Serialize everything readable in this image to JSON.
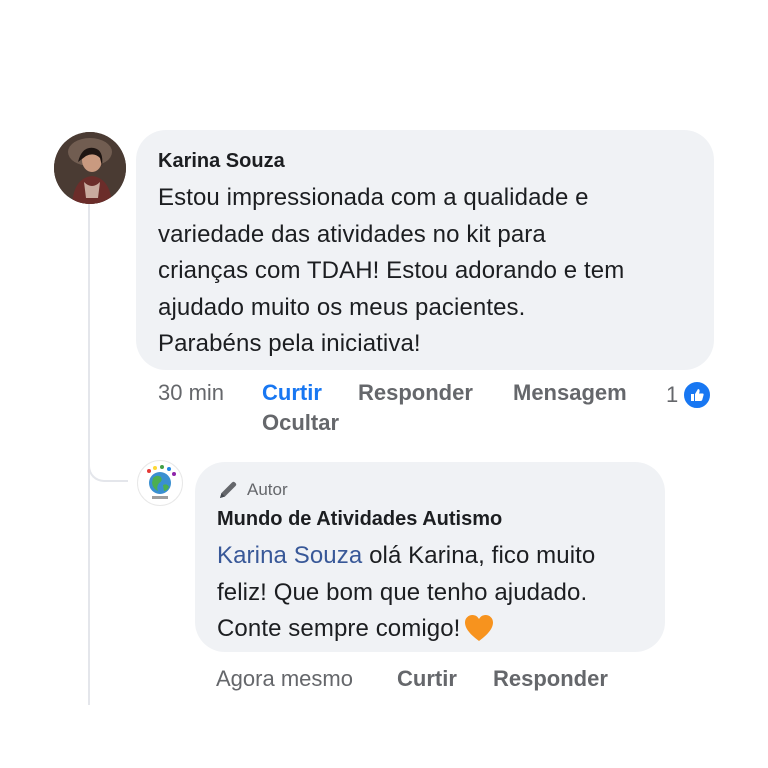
{
  "main_comment": {
    "author": "Karina Souza",
    "lines": [
      "Estou impressionada com a qualidade e",
      "variedade das atividades no kit para",
      "crianças com TDAH! Estou adorando e tem",
      "ajudado muito os meus pacientes.",
      "Parabéns pela iniciativa!"
    ],
    "time": "30 min",
    "like_label": "Curtir",
    "reply_label": "Responder",
    "message_label": "Mensagem",
    "hide_label": "Ocultar",
    "reaction_count": "1",
    "reaction_icon": "thumbs-up-icon"
  },
  "reply": {
    "badge": "Autor",
    "badge_icon": "pencil-icon",
    "author": "Mundo de Atividades Autismo",
    "mention": "Karina Souza",
    "line1_rest": " olá Karina, fico muito",
    "line2": "feliz! Que bom que tenho ajudado.",
    "line3": "Conte sempre comigo!",
    "emoji": "orange-heart",
    "time": "Agora mesmo",
    "like_label": "Curtir",
    "reply_label": "Responder"
  },
  "colors": {
    "bubble_bg": "#f0f2f5",
    "link_blue": "#1877f2",
    "mention_blue": "#385898",
    "meta_gray": "#65676b",
    "heart_orange": "#f7931e"
  }
}
